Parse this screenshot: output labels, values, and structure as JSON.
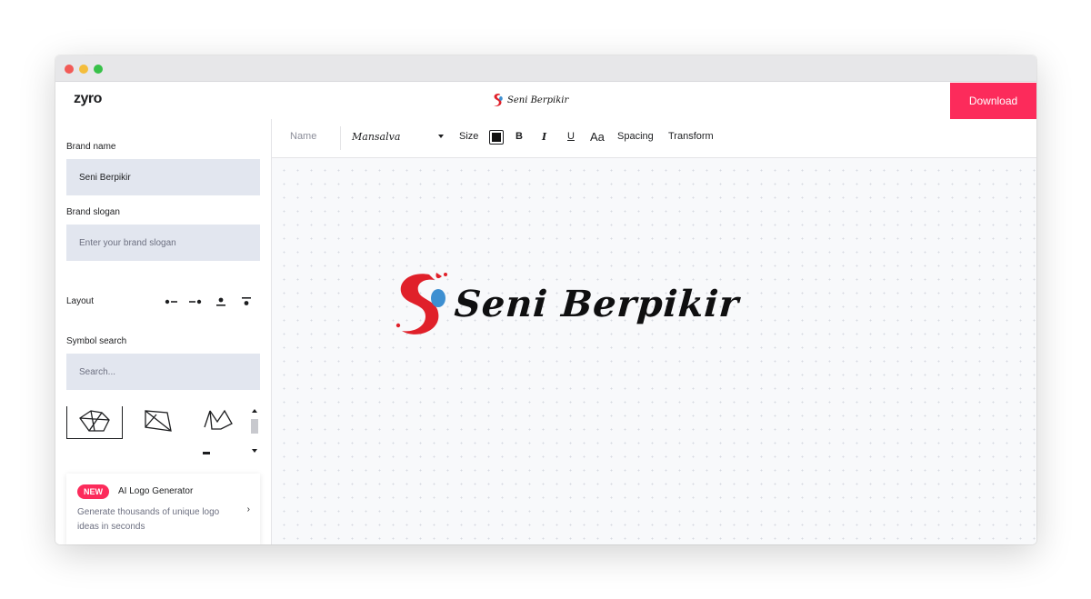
{
  "window": {
    "traffic_lights": [
      "close",
      "minimize",
      "maximize"
    ]
  },
  "appbar": {
    "app_name": "zyro",
    "preview_text": "Seni Berpikir",
    "download_label": "Download",
    "accent_color": "#fc2b5b"
  },
  "sidebar": {
    "brand_name_label": "Brand name",
    "brand_name_value": "Seni Berpikir",
    "brand_slogan_label": "Brand slogan",
    "brand_slogan_placeholder": "Enter your brand slogan",
    "layout_label": "Layout",
    "layout_options": [
      "icon-left-text",
      "text-right-icon",
      "icon-above-text",
      "text-below-icon"
    ],
    "symbol_search_label": "Symbol search",
    "symbol_search_placeholder": "Search...",
    "promo": {
      "badge": "NEW",
      "title": "AI Logo Generator",
      "description": "Generate thousands of unique logo ideas in seconds"
    }
  },
  "toolbar": {
    "name_label": "Name",
    "font_value": "Mansalva",
    "size_label": "Size",
    "text_color": "#111111",
    "bold_label": "B",
    "italic_label": "I",
    "underline_label": "U",
    "case_label": "Aa",
    "spacing_label": "Spacing",
    "transform_label": "Transform"
  },
  "canvas": {
    "brand_text": "Seni Berpikir",
    "symbol_colors": [
      "#e0202a",
      "#3d8fd1"
    ]
  }
}
